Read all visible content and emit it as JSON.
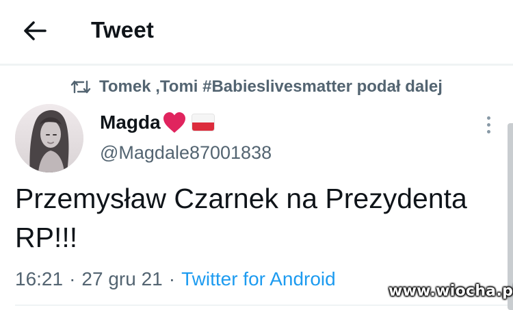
{
  "header": {
    "title": "Tweet",
    "back_icon": "arrow-left-icon"
  },
  "retweet": {
    "icon": "retweet-icon",
    "text": "Tomek ,Tomi #Babieslivesmatter podał dalej"
  },
  "author": {
    "display_name": "Magda",
    "emoji": [
      "red-heart-icon",
      "poland-flag-icon"
    ],
    "handle": "@Magdale87001838"
  },
  "tweet": {
    "text": "Przemysław Czarnek na Prezydenta RP!!!"
  },
  "meta": {
    "time": "16:21",
    "separator": "·",
    "date": "27 gru 21",
    "source": "Twitter for Android"
  },
  "watermark": "www.wiocha.pl",
  "colors": {
    "text_primary": "#0f1419",
    "text_secondary": "#536471",
    "link": "#1d9bf0",
    "heart": "#e0245e",
    "flag_red": "#dc2c3c"
  }
}
